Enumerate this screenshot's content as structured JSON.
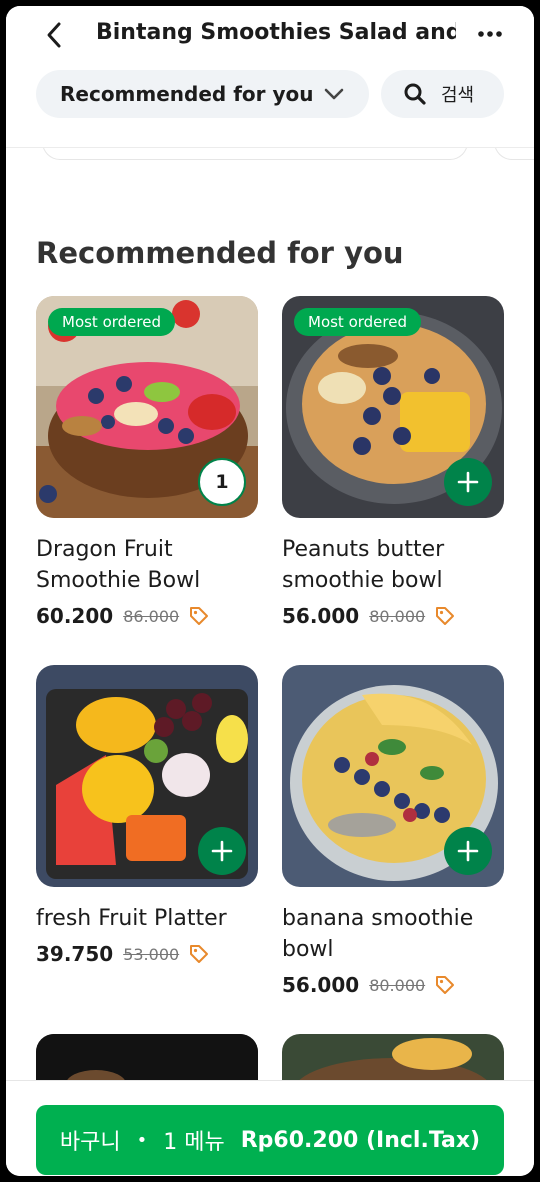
{
  "header": {
    "title": "Bintang Smoothies Salad and...",
    "category_label": "Recommended for you",
    "search_label": "검색"
  },
  "section": {
    "title": "Recommended for you"
  },
  "products": [
    {
      "name": "Dragon Fruit Smoothie Bowl",
      "price": "60.200",
      "old_price": "86.000",
      "badge": "Most ordered",
      "quantity": "1"
    },
    {
      "name": "Peanuts butter smoothie bowl",
      "price": "56.000",
      "old_price": "80.000",
      "badge": "Most ordered"
    },
    {
      "name": "fresh Fruit Platter",
      "price": "39.750",
      "old_price": "53.000"
    },
    {
      "name": "banana smoothie bowl",
      "price": "56.000",
      "old_price": "80.000"
    }
  ],
  "basket": {
    "label": "바구니",
    "separator": "•",
    "count": "1 메뉴",
    "total": "Rp60.200 (Incl.Tax)"
  },
  "colors": {
    "accent_green": "#00b050",
    "dark_green": "#00834a",
    "tag_orange": "#e8892c"
  },
  "icons": [
    "back-icon",
    "more-icon",
    "chevron-down-icon",
    "search-icon",
    "plus-icon",
    "price-tag-icon"
  ]
}
